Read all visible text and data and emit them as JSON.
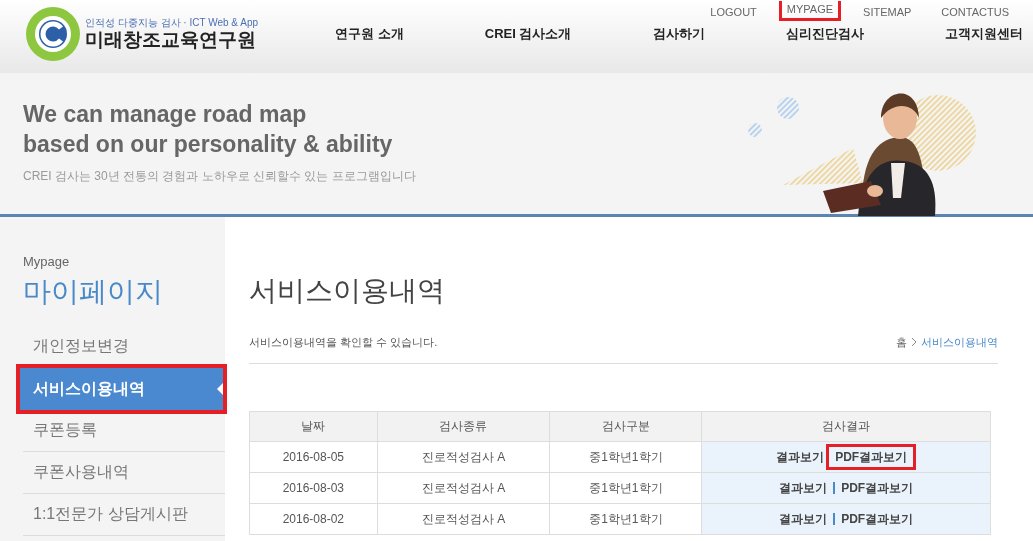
{
  "top_links": [
    {
      "label": "LOGOUT",
      "highlighted": false
    },
    {
      "label": "MYPAGE",
      "highlighted": true
    },
    {
      "label": "SITEMAP",
      "highlighted": false
    },
    {
      "label": "CONTACTUS",
      "highlighted": false
    }
  ],
  "logo": {
    "tagline": "인적성 다중지능 검사 · ICT Web & App",
    "name": "미래창조교육연구원"
  },
  "nav": [
    "연구원 소개",
    "CREI 검사소개",
    "검사하기",
    "심리진단검사",
    "고객지원센터"
  ],
  "banner": {
    "headline_lines": [
      "We can manage road map",
      "based on our personality & ability"
    ],
    "subtitle": "CREI 검사는 30년 전통의 경험과 노하우로 신뢰할수 있는 프로그램입니다"
  },
  "sidebar": {
    "caption": "Mypage",
    "title": "마이페이지",
    "items": [
      {
        "label": "개인정보변경",
        "selected": false,
        "highlighted": false
      },
      {
        "label": "서비스이용내역",
        "selected": true,
        "highlighted": true
      },
      {
        "label": "쿠폰등록",
        "selected": false,
        "highlighted": false
      },
      {
        "label": "쿠폰사용내역",
        "selected": false,
        "highlighted": false
      },
      {
        "label": "1:1전문가 상담게시판",
        "selected": false,
        "highlighted": false
      }
    ]
  },
  "main": {
    "title": "서비스이용내역",
    "description": "서비스이용내역을 확인할 수 있습니다.",
    "breadcrumb": [
      {
        "label": "홈",
        "current": false
      },
      {
        "label": "서비스이용내역",
        "current": true
      }
    ]
  },
  "table": {
    "columns": [
      "날짜",
      "검사종류",
      "검사구분",
      "검사결과"
    ],
    "rows": [
      {
        "date": "2016-08-05",
        "test_type": "진로적성검사 A",
        "test_category": "중1학년1학기",
        "result_links": [
          {
            "label": "결과보기",
            "highlighted": false
          },
          {
            "label": "PDF결과보기",
            "highlighted": true
          }
        ]
      },
      {
        "date": "2016-08-03",
        "test_type": "진로적성검사 A",
        "test_category": "중1학년1학기",
        "result_links": [
          {
            "label": "결과보기",
            "highlighted": false
          },
          {
            "label": "PDF결과보기",
            "highlighted": false
          }
        ]
      },
      {
        "date": "2016-08-02",
        "test_type": "진로적성검사 A",
        "test_category": "중1학년1학기",
        "result_links": [
          {
            "label": "결과보기",
            "highlighted": false
          },
          {
            "label": "PDF결과보기",
            "highlighted": false
          }
        ]
      }
    ]
  }
}
